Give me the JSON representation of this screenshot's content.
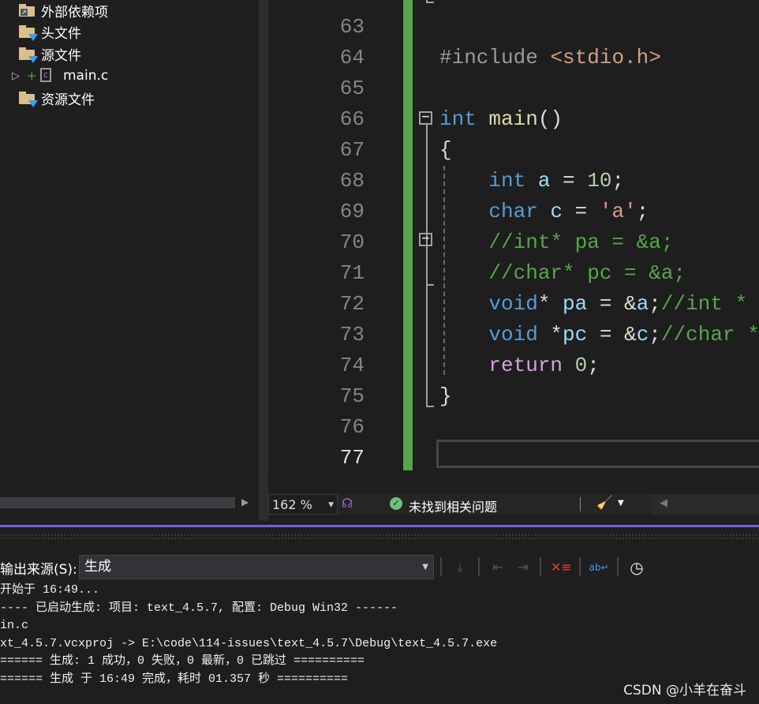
{
  "solution_explorer": {
    "items": [
      {
        "label": "外部依赖项",
        "icon": "external-deps-folder-icon"
      },
      {
        "label": "头文件",
        "icon": "filter-folder-icon"
      },
      {
        "label": "源文件",
        "icon": "filter-folder-icon"
      },
      {
        "label": "main.c",
        "icon": "c-file-icon"
      },
      {
        "label": "资源文件",
        "icon": "filter-folder-icon"
      }
    ]
  },
  "editor": {
    "line_numbers": [
      "63",
      "64",
      "65",
      "66",
      "67",
      "68",
      "69",
      "70",
      "71",
      "72",
      "73",
      "74",
      "75",
      "76",
      "77"
    ],
    "colors": {
      "keyword": "#569cd6",
      "preproc": "#9b9b9b",
      "string": "#d69d85",
      "comment": "#57a64a",
      "func": "#dcdcaa",
      "var": "#9cdcfe",
      "number": "#b5cea8",
      "text": "#dcdcdc",
      "return": "#d8a0df"
    },
    "lines": [
      [],
      [
        {
          "t": "#include ",
          "c": "preproc"
        },
        {
          "t": "<stdio.h>",
          "c": "string"
        }
      ],
      [],
      [
        {
          "t": "int",
          "c": "keyword"
        },
        {
          "t": " ",
          "c": "text"
        },
        {
          "t": "main",
          "c": "func"
        },
        {
          "t": "()",
          "c": "text"
        }
      ],
      [
        {
          "t": "{",
          "c": "text"
        }
      ],
      [
        {
          "t": "    int",
          "c": "keyword"
        },
        {
          "t": " ",
          "c": "text"
        },
        {
          "t": "a",
          "c": "var"
        },
        {
          "t": " = ",
          "c": "text"
        },
        {
          "t": "10",
          "c": "number"
        },
        {
          "t": ";",
          "c": "text"
        }
      ],
      [
        {
          "t": "    char",
          "c": "keyword"
        },
        {
          "t": " ",
          "c": "text"
        },
        {
          "t": "c",
          "c": "var"
        },
        {
          "t": " = ",
          "c": "text"
        },
        {
          "t": "'a'",
          "c": "string"
        },
        {
          "t": ";",
          "c": "text"
        }
      ],
      [
        {
          "t": "    //int* pa = &a;",
          "c": "comment"
        }
      ],
      [
        {
          "t": "    //char* pc = &a;",
          "c": "comment"
        }
      ],
      [
        {
          "t": "    void",
          "c": "keyword"
        },
        {
          "t": "* ",
          "c": "text"
        },
        {
          "t": "pa",
          "c": "var"
        },
        {
          "t": " = &",
          "c": "text"
        },
        {
          "t": "a",
          "c": "var"
        },
        {
          "t": ";",
          "c": "text"
        },
        {
          "t": "//int *",
          "c": "comment"
        }
      ],
      [
        {
          "t": "    void",
          "c": "keyword"
        },
        {
          "t": " *",
          "c": "text"
        },
        {
          "t": "pc",
          "c": "var"
        },
        {
          "t": " = &",
          "c": "text"
        },
        {
          "t": "c",
          "c": "var"
        },
        {
          "t": ";",
          "c": "text"
        },
        {
          "t": "//char *",
          "c": "comment"
        }
      ],
      [
        {
          "t": "    return",
          "c": "return"
        },
        {
          "t": " ",
          "c": "text"
        },
        {
          "t": "0",
          "c": "number"
        },
        {
          "t": ";",
          "c": "text"
        }
      ],
      [
        {
          "t": "}",
          "c": "text"
        }
      ],
      [],
      []
    ]
  },
  "status_bar": {
    "zoom": "162 %",
    "issues": "未找到相关问题"
  },
  "output": {
    "source_label": "输出来源(S):",
    "source_value": "生成",
    "lines": [
      "开始于 16:49...",
      "---- 已启动生成: 项目: text_4.5.7, 配置: Debug Win32 ------",
      "in.c",
      "xt_4.5.7.vcxproj -> E:\\code\\114-issues\\text_4.5.7\\Debug\\text_4.5.7.exe",
      "====== 生成: 1 成功，0 失败，0 最新，0 已跳过 ==========",
      "====== 生成 于 16:49 完成，耗时 01.357 秒 =========="
    ]
  },
  "watermark": "CSDN @小羊在奋斗"
}
